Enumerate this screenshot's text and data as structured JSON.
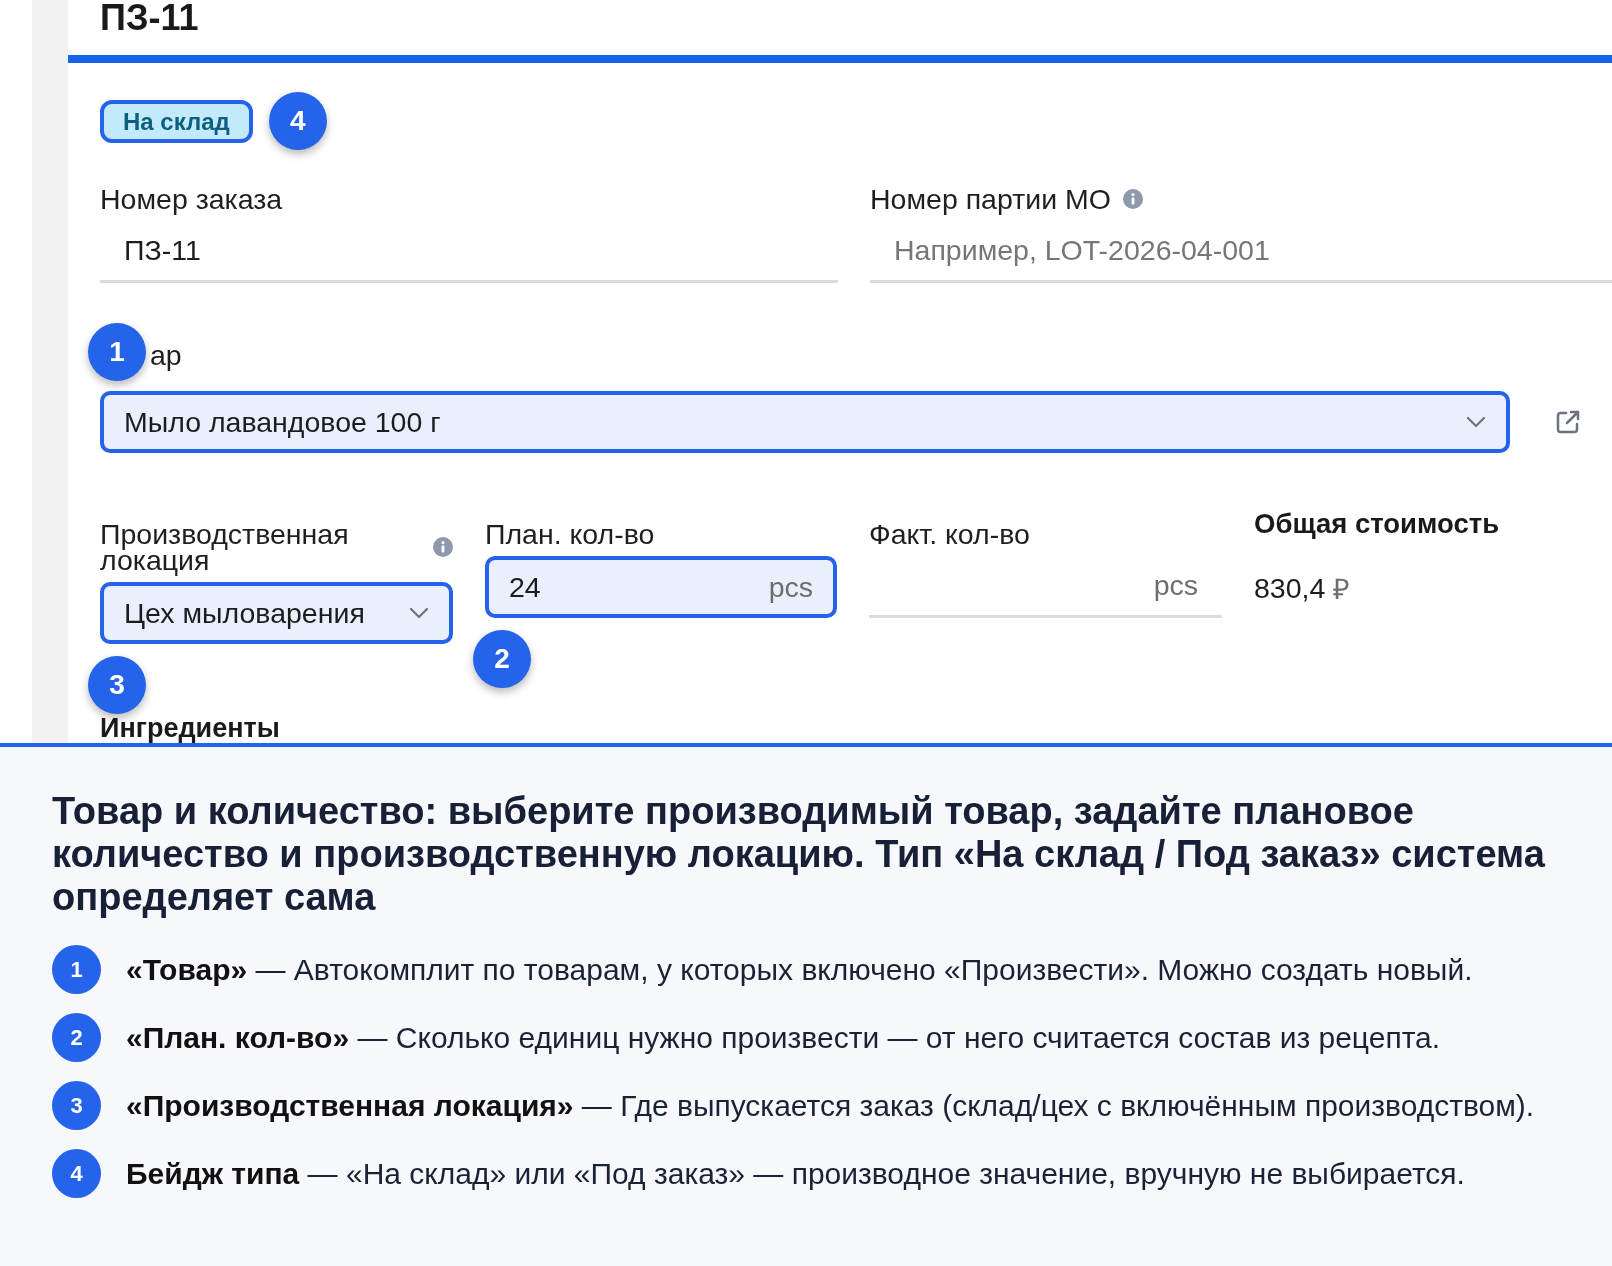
{
  "page": {
    "title": "ПЗ-11"
  },
  "badge": {
    "label": "На склад",
    "highlighted": true,
    "marker": "4"
  },
  "form": {
    "rows": [
      {
        "fields": [
          {
            "kind": "input",
            "label": "Номер заказа",
            "value": "ПЗ-11",
            "highlighted": false
          },
          {
            "kind": "input",
            "label": "Номер партии МО",
            "info": true,
            "placeholder": "Например, LOT-2026-04-001",
            "highlighted": false
          }
        ]
      },
      {
        "fields": [
          {
            "kind": "select",
            "label": "ар",
            "marker": "1",
            "value": "Мыло лавандовое 100 г",
            "highlighted": true,
            "open_link": true
          }
        ]
      },
      {
        "fields": [
          {
            "kind": "select",
            "label": "Производственная локация",
            "info": true,
            "value": "Цех мыловарения",
            "highlighted": true,
            "marker": "3"
          },
          {
            "kind": "input",
            "label": "План. кол-во",
            "value": "24",
            "unit": "pcs",
            "highlighted": true,
            "marker": "2"
          },
          {
            "kind": "input",
            "label": "Факт. кол-во",
            "unit": "pcs",
            "highlighted": false
          },
          {
            "kind": "total",
            "label": "Общая стоимость",
            "value": "830,4",
            "currency": "₽"
          }
        ]
      }
    ]
  },
  "section": {
    "heading": "Ингредиенты"
  },
  "help": {
    "title": "Товар и количество: выберите производимый товар, задайте плановое количество и производственную локацию. Тип «На склад / Под заказ» система определяет сама",
    "items": [
      {
        "marker": "1",
        "text": "**«Товар»** — Автокомплит по товарам, у которых включено «Произвести». Можно создать новый."
      },
      {
        "marker": "2",
        "text": "**«План. кол-во»** — Сколько единиц нужно произвести — от него считается состав из рецепта."
      },
      {
        "marker": "3",
        "text": "**«Производственная локация»** — Где выпускается заказ (склад/цех с включённым производством)."
      },
      {
        "marker": "4",
        "text": "**Бейдж типа** — «На склад» или «Под заказ» — производное значение, вручную не выбирается."
      }
    ]
  }
}
